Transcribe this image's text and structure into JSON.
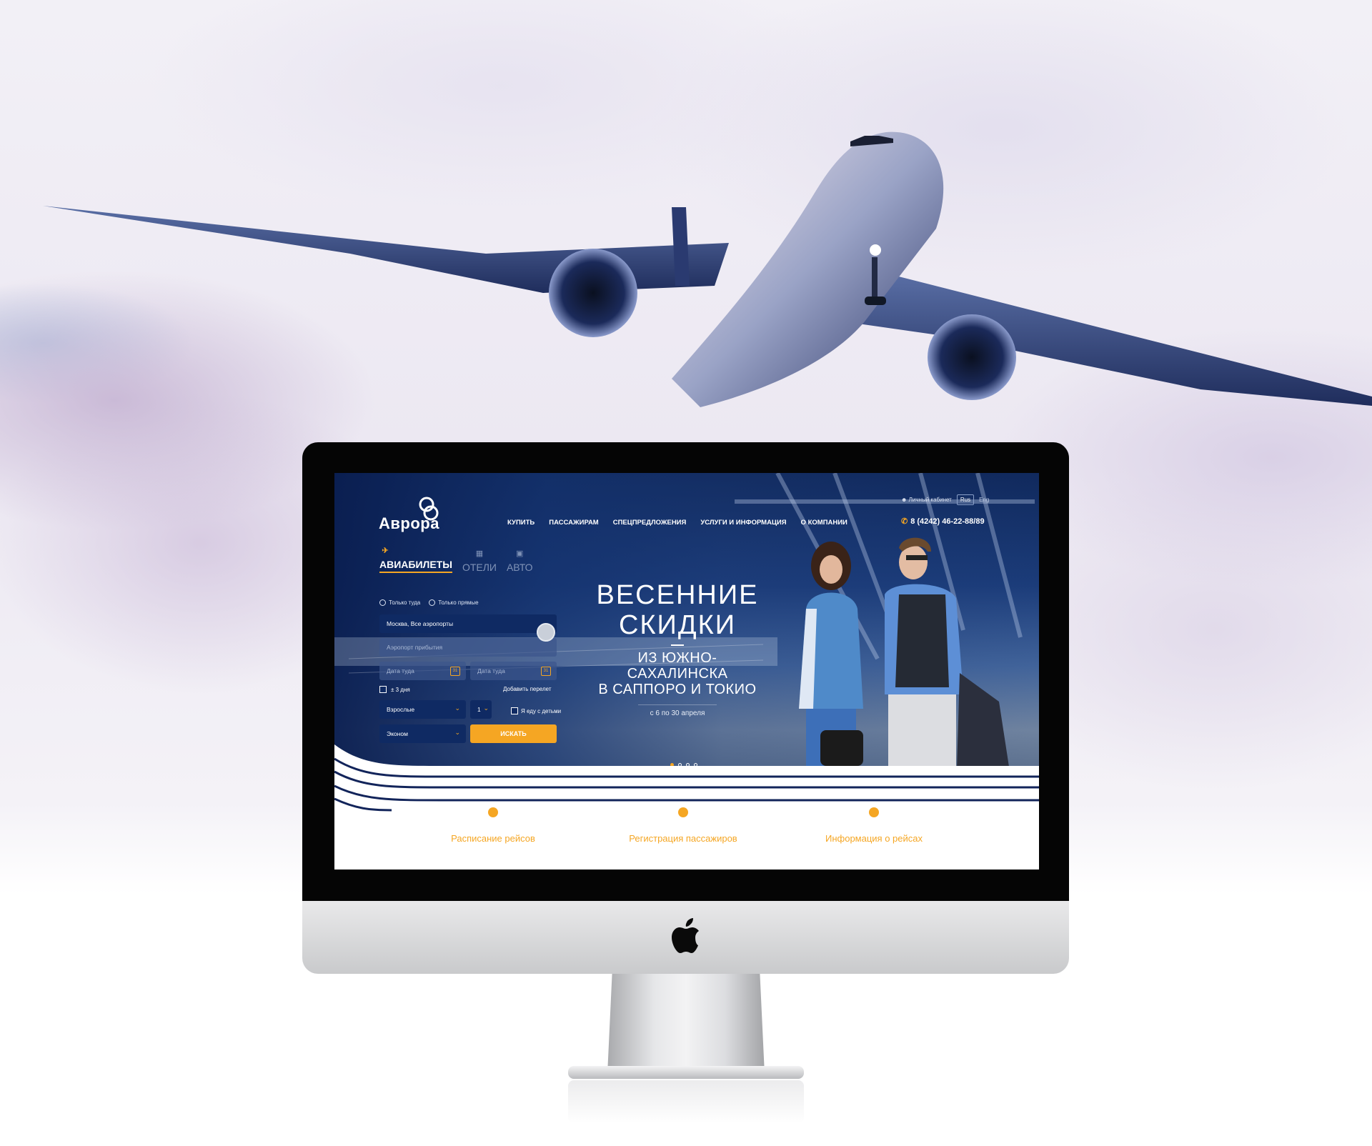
{
  "site": {
    "logo_text": "Аврора",
    "nav": [
      "КУПИТЬ",
      "ПАССАЖИРАМ",
      "СПЕЦПРЕДЛОЖЕНИЯ",
      "УСЛУГИ И ИНФОРМАЦИЯ",
      "О КОМПАНИИ"
    ],
    "account_label": "Личный кабинет",
    "lang_active": "Rus",
    "lang_other": "Eng",
    "phone": "8 (4242) 46-22-88/89"
  },
  "search": {
    "tabs": [
      "АВИАБИЛЕТЫ",
      "ОТЕЛИ",
      "АВТО"
    ],
    "radio_oneway": "Только туда",
    "radio_direct": "Только прямые",
    "from_value": "Москва, Все аэропорты",
    "to_placeholder": "Аэропорт прибытия",
    "date_there": "Дата туда",
    "date_back": "Дата туда",
    "calendar_num": "31",
    "flex_days": "± 3 дня",
    "add_flight": "Добавить перелет",
    "passenger_type": "Взрослые",
    "passenger_count": "1",
    "kids_label": "Я еду с детьми",
    "class_value": "Эконом",
    "search_button": "ИСКАТЬ"
  },
  "promo": {
    "title_line1": "ВЕСЕННИЕ",
    "title_line2": "СКИДКИ",
    "sub_line1": "ИЗ ЮЖНО-САХАЛИНСКА",
    "sub_line2": "В САППОРО И ТОКИО",
    "dates": "с 6 по 30 апреля"
  },
  "slider": {
    "count": 4,
    "active": 1
  },
  "quick_links": [
    "Расписание рейсов",
    "Регистрация пассажиров",
    "Информация о рейсах"
  ],
  "colors": {
    "accent": "#f5a623",
    "navy": "#0f2a63"
  }
}
